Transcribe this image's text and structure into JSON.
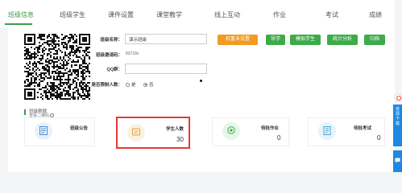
{
  "nav": {
    "tabs": [
      {
        "label": "班级信息",
        "active": true
      },
      {
        "label": "班级学生"
      },
      {
        "label": "课件设置"
      },
      {
        "label": "课堂教学"
      },
      {
        "label": "线上互动"
      },
      {
        "label": "作业"
      },
      {
        "label": "考试"
      },
      {
        "label": "成绩"
      }
    ]
  },
  "qr": {
    "caption": "查看二维码"
  },
  "form": {
    "class_name_label": "班级名称：",
    "class_name_value": "演示班级",
    "invite_code_label": "班级邀请码：",
    "invite_code_value": "83718v",
    "qq_label": "QQ群：",
    "qq_value": "",
    "limit_label": "是否限制人数：",
    "limit_options": [
      {
        "label": "是",
        "selected": false
      },
      {
        "label": "否",
        "selected": true
      }
    ]
  },
  "actions": [
    {
      "label": "权重未设置",
      "color": "#f19a24"
    },
    {
      "label": "导学",
      "color": "#3dab49"
    },
    {
      "label": "模拟学生",
      "color": "#3dab49"
    },
    {
      "label": "统计分析",
      "color": "#3dab49"
    },
    {
      "label": "归档",
      "color": "#3dab49"
    }
  ],
  "stats": {
    "title": "班级数据",
    "cards": [
      {
        "label": "班级公告",
        "value": "",
        "icon": "notice-icon"
      },
      {
        "label": "学生人数",
        "value": "30",
        "icon": "students-icon",
        "highlighted": true
      },
      {
        "label": "待批作业",
        "value": "0",
        "icon": "homework-icon"
      },
      {
        "label": "待批考试",
        "value": "0",
        "icon": "exam-icon"
      }
    ]
  },
  "side": {
    "download_label": "资源下载"
  },
  "colors": {
    "accent": "#3a9e47",
    "orange": "#f19a24",
    "highlight": "#e53935",
    "side_blue": "#1e88e5"
  }
}
